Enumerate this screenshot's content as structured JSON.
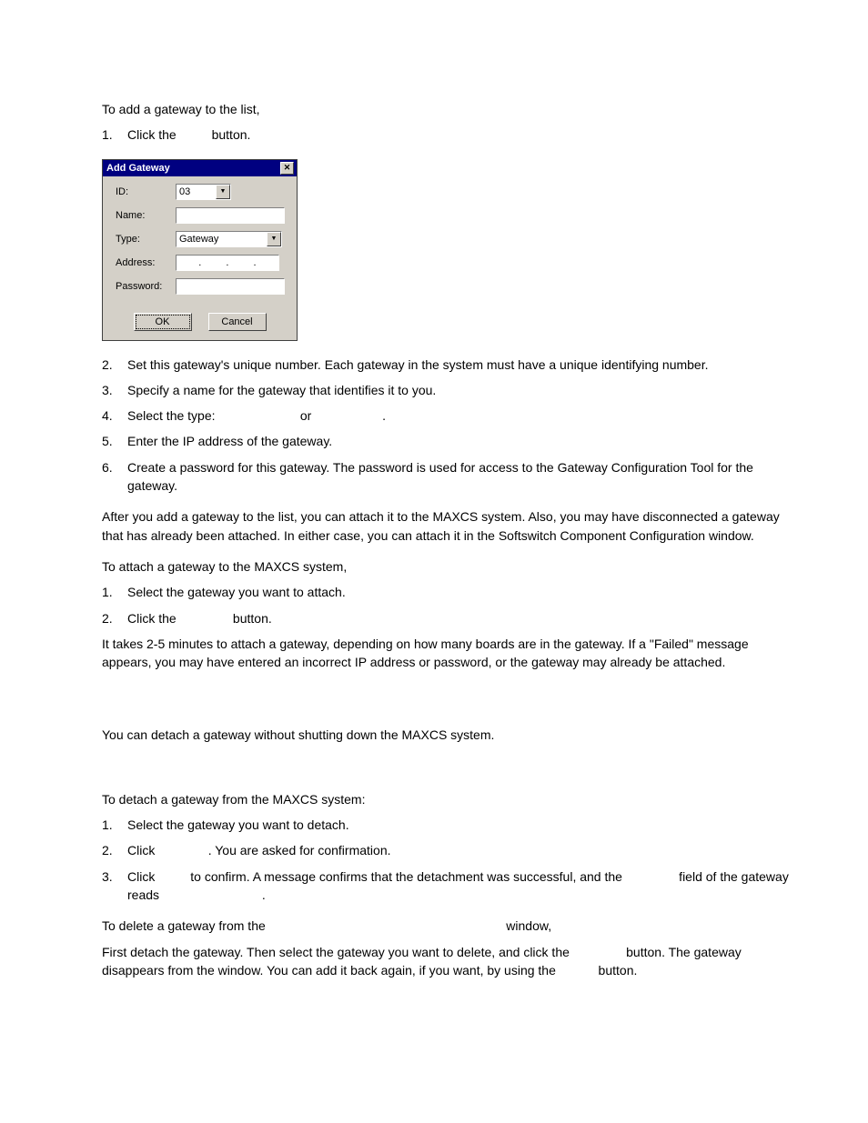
{
  "intro": "To add a gateway to the list,",
  "step_add": [
    {
      "n": "1.",
      "pre": "Click the ",
      "post": " button."
    },
    {
      "n": "2.",
      "text": "Set this gateway's unique number. Each gateway in the system must have a unique identifying number."
    },
    {
      "n": "3.",
      "text": "Specify a name for the gateway that identifies it to you."
    },
    {
      "n": "4.",
      "pre": "Select the type: ",
      "mid": " or ",
      "post": "."
    },
    {
      "n": "5.",
      "text": "Enter the IP address of the gateway."
    },
    {
      "n": "6.",
      "text": "Create a password for this gateway. The password is used for access to the Gateway Configuration Tool for the gateway."
    }
  ],
  "after_add": "After you add a gateway to the list, you can attach it to the MAXCS system. Also, you may have disconnected a gateway that has already been attached. In either case, you can attach it in the Softswitch Component Configuration window.",
  "attach_intro": "To attach a gateway to the MAXCS system,",
  "step_attach": [
    {
      "n": "1.",
      "text": "Select the gateway you want to attach."
    },
    {
      "n": "2.",
      "pre": "Click the ",
      "post": " button."
    }
  ],
  "attach_note": "It takes 2-5 minutes to attach a gateway, depending on how many boards are in the gateway. If a \"Failed\" message appears, you may have entered an incorrect IP address or password, or the gateway may already be attached.",
  "detach_can": "You can detach a gateway without shutting down the MAXCS system.",
  "detach_intro": "To detach a gateway from the MAXCS system:",
  "step_detach": [
    {
      "n": "1.",
      "text": "Select the gateway you want to detach."
    },
    {
      "n": "2.",
      "pre": "Click ",
      "post": ". You are asked for confirmation."
    },
    {
      "n": "3.",
      "pre": "Click ",
      "mid": " to confirm. A message confirms that the detachment was successful, and the ",
      "post": " field of the gateway reads ",
      "end": "."
    }
  ],
  "delete_intro_pre": "To delete a gateway from the ",
  "delete_intro_post": " window,",
  "delete_body_pre": "First detach the gateway. Then select the gateway you want to delete, and click the ",
  "delete_body_mid": " button. The gateway disappears from the window. You can add it back again, if you want, by using the ",
  "delete_body_post": " button.",
  "dialog": {
    "title": "Add Gateway",
    "labels": {
      "id": "ID:",
      "name": "Name:",
      "type": "Type:",
      "address": "Address:",
      "password": "Password:"
    },
    "id_value": "03",
    "type_value": "Gateway",
    "ok": "OK",
    "cancel": "Cancel"
  }
}
